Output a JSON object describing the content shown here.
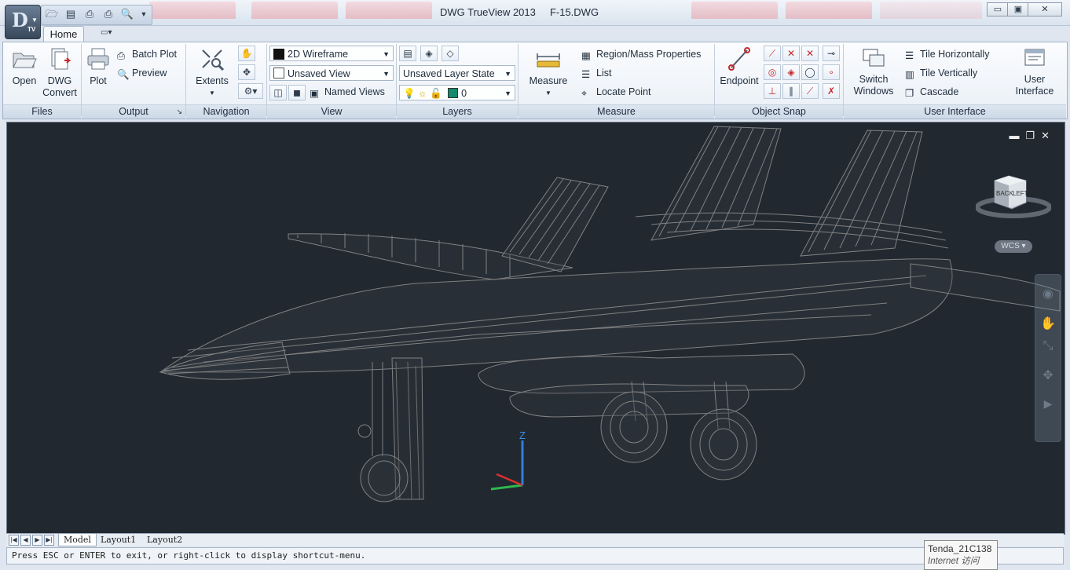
{
  "titlebar": {
    "app": "DWG TrueView 2013",
    "file": "F-15.DWG",
    "min": "▭",
    "max": "▣",
    "close": "✕"
  },
  "tabs": {
    "home": "Home"
  },
  "files": {
    "open": "Open",
    "convert_1": "DWG",
    "convert_2": "Convert",
    "label": "Files"
  },
  "output": {
    "plot": "Plot",
    "batch_plot": "Batch Plot",
    "preview": "Preview",
    "label": "Output",
    "launcher": "↘"
  },
  "navigation": {
    "extents": "Extents",
    "label": "Navigation"
  },
  "view": {
    "visual_style": "2D Wireframe",
    "named_view": "Unsaved View",
    "named_views": "Named Views",
    "label": "View"
  },
  "layers": {
    "layer_state": "Unsaved Layer State",
    "current_layer": "0",
    "label": "Layers"
  },
  "measure": {
    "measure": "Measure",
    "region": "Region/Mass Properties",
    "list": "List",
    "locate": "Locate Point",
    "label": "Measure"
  },
  "object_snap": {
    "endpoint": "Endpoint",
    "label": "Object Snap"
  },
  "user_interface": {
    "switch_1": "Switch",
    "switch_2": "Windows",
    "tile_h": "Tile Horizontally",
    "tile_v": "Tile Vertically",
    "cascade": "Cascade",
    "ui_1": "User",
    "ui_2": "Interface",
    "label": "User Interface"
  },
  "viewport": {
    "wcs": "WCS",
    "viewcube_left": "LEFT",
    "viewcube_back": "BACK",
    "axis_z": "Z"
  },
  "layout_tabs": [
    "Model",
    "Layout1",
    "Layout2"
  ],
  "command_line": "Press ESC or ENTER to exit, or right-click to display shortcut-menu.",
  "tooltip": {
    "title": "Tenda_21C138",
    "subtitle": "Internet 访问"
  }
}
